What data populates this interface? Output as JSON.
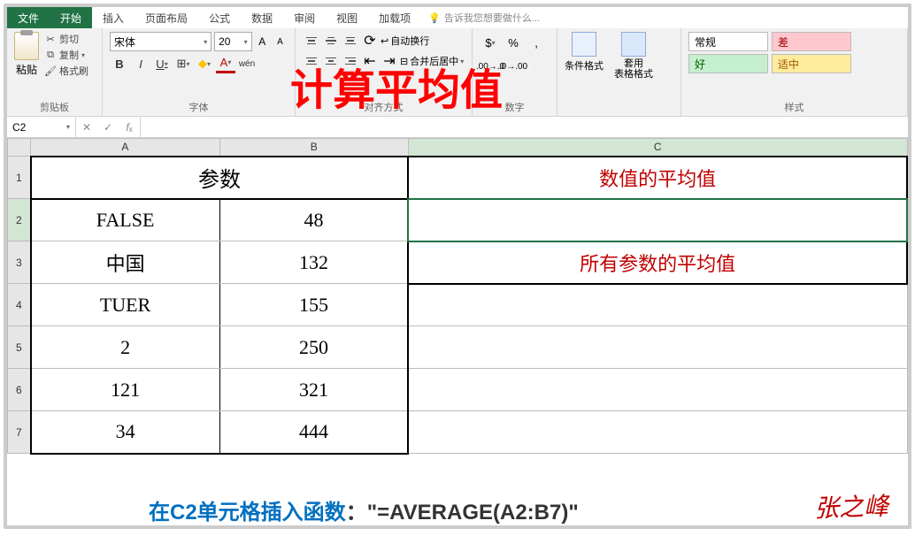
{
  "menu": {
    "file": "文件",
    "home": "开始",
    "insert": "插入",
    "layout": "页面布局",
    "formulas": "公式",
    "data": "数据",
    "review": "审阅",
    "view": "视图",
    "addins": "加载项",
    "tell": "告诉我您想要做什么..."
  },
  "ribbon": {
    "paste": "粘贴",
    "cut": "剪切",
    "copy": "复制",
    "format_painter": "格式刷",
    "clipboard_label": "剪贴板",
    "font_name": "宋体",
    "font_size": "20",
    "font_label": "字体",
    "align_label": "对齐方式",
    "wrap": "自动换行",
    "merge": "合并后居中",
    "number_label": "数字",
    "cond_fmt": "条件格式",
    "table_fmt": "套用\n表格格式",
    "style_normal": "常规",
    "style_bad": "差",
    "style_good": "好",
    "style_neutral": "适中",
    "style_label": "样式"
  },
  "overlay_title": "计算平均值",
  "name_box": "C2",
  "grid": {
    "cols": [
      "A",
      "B",
      "C"
    ],
    "rows": [
      "1",
      "2",
      "3",
      "4",
      "5",
      "6",
      "7"
    ],
    "merged_ab1": "参数",
    "c1": "数值的平均值",
    "c3": "所有参数的平均值",
    "data": {
      "a2": "FALSE",
      "b2": "48",
      "a3": "中国",
      "b3": "132",
      "a4": "TUER",
      "b4": "155",
      "a5": "2",
      "b5": "250",
      "a6": "121",
      "b6": "321",
      "a7": "34",
      "b7": "444"
    }
  },
  "footer": {
    "pre": "在C2单元格插入函数",
    "colon": "：",
    "formula": "\"=AVERAGE(A2:B7)\""
  },
  "signature": "张之峰"
}
